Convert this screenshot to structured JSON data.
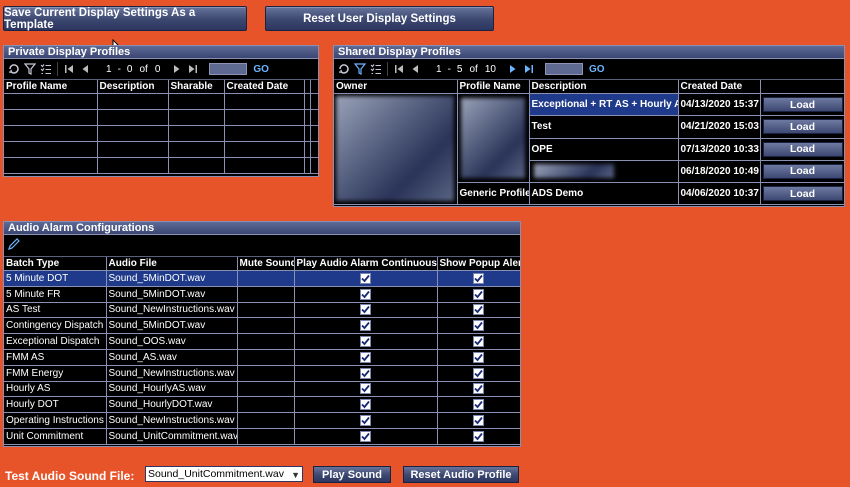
{
  "toolbar": {
    "save_template_label": "Save Current Display Settings As a Template",
    "reset_user_label": "Reset User Display Settings"
  },
  "private_profiles": {
    "title": "Private Display Profiles",
    "pager": {
      "from": "1",
      "dash": "-",
      "to": "0",
      "of_label": "of",
      "total": "0",
      "go_label": "GO"
    },
    "columns": [
      "Profile Name",
      "Description",
      "Sharable",
      "Created Date"
    ]
  },
  "shared_profiles": {
    "title": "Shared Display Profiles",
    "pager": {
      "from": "1",
      "dash": "-",
      "to": "5",
      "of_label": "of",
      "total": "10",
      "go_label": "GO"
    },
    "columns": [
      "Owner",
      "Profile Name",
      "Description",
      "Created Date",
      ""
    ],
    "rows": [
      {
        "description": "Exceptional + RT AS + Hourly AS",
        "created": "04/13/2020 15:37",
        "action": "Load"
      },
      {
        "description": "Test",
        "created": "04/21/2020 15:03",
        "action": "Load"
      },
      {
        "description": "OPE",
        "created": "07/13/2020 10:33",
        "action": "Load"
      },
      {
        "description": "",
        "created": "06/18/2020 10:49",
        "action": "Load"
      },
      {
        "profile_name": "Generic Profile",
        "description": "ADS Demo",
        "created": "04/06/2020 10:37",
        "action": "Load"
      }
    ]
  },
  "audio_alarms": {
    "title": "Audio Alarm Configurations",
    "columns": [
      "Batch Type",
      "Audio File",
      "Mute Sound",
      "Play Audio Alarm Continuously",
      "Show Popup Alert"
    ],
    "rows": [
      {
        "batch_type": "5 Minute DOT",
        "audio_file": "Sound_5MinDOT.wav",
        "mute": false,
        "play": true,
        "popup": true
      },
      {
        "batch_type": "5 Minute FR",
        "audio_file": "Sound_5MinDOT.wav",
        "mute": false,
        "play": true,
        "popup": true
      },
      {
        "batch_type": "AS Test",
        "audio_file": "Sound_NewInstructions.wav",
        "mute": false,
        "play": true,
        "popup": true
      },
      {
        "batch_type": "Contingency Dispatch",
        "audio_file": "Sound_5MinDOT.wav",
        "mute": false,
        "play": true,
        "popup": true
      },
      {
        "batch_type": "Exceptional Dispatch",
        "audio_file": "Sound_OOS.wav",
        "mute": false,
        "play": true,
        "popup": true
      },
      {
        "batch_type": "FMM AS",
        "audio_file": "Sound_AS.wav",
        "mute": false,
        "play": true,
        "popup": true
      },
      {
        "batch_type": "FMM Energy",
        "audio_file": "Sound_NewInstructions.wav",
        "mute": false,
        "play": true,
        "popup": true
      },
      {
        "batch_type": "Hourly AS",
        "audio_file": "Sound_HourlyAS.wav",
        "mute": false,
        "play": true,
        "popup": true
      },
      {
        "batch_type": "Hourly DOT",
        "audio_file": "Sound_HourlyDOT.wav",
        "mute": false,
        "play": true,
        "popup": true
      },
      {
        "batch_type": "Operating Instructions",
        "audio_file": "Sound_NewInstructions.wav",
        "mute": false,
        "play": true,
        "popup": true
      },
      {
        "batch_type": "Unit Commitment",
        "audio_file": "Sound_UnitCommitment.wav",
        "mute": false,
        "play": true,
        "popup": true
      }
    ]
  },
  "test_audio": {
    "label": "Test Audio Sound File:",
    "selected": "Sound_UnitCommitment.wav",
    "play_label": "Play Sound",
    "reset_label": "Reset Audio Profile"
  },
  "colors": {
    "background": "#e8542a",
    "panel_header": "#3b4672",
    "selected_row": "#1f3a8a",
    "link": "#6cb4ff"
  }
}
